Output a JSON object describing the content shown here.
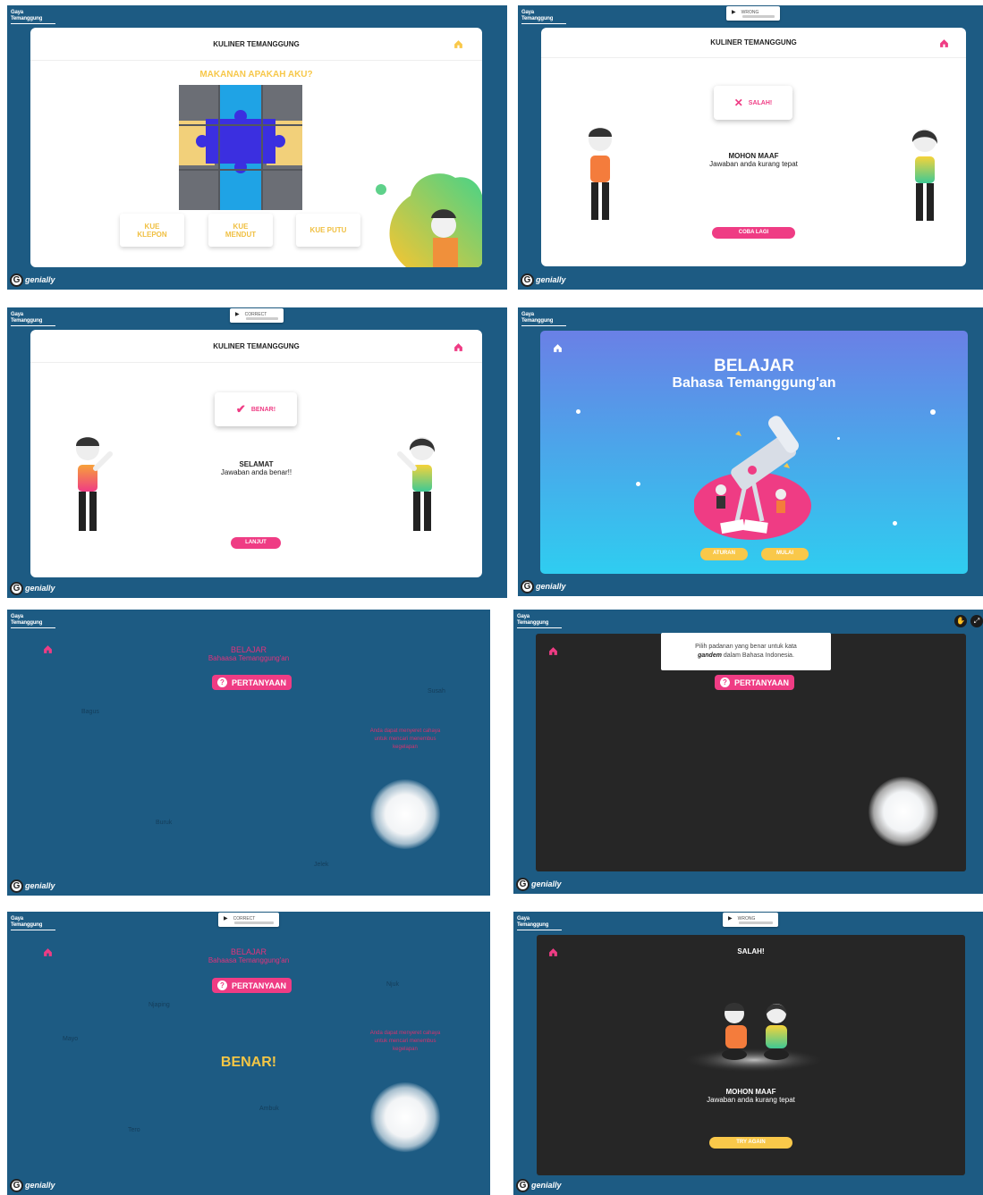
{
  "branding": {
    "logo_line1": "Gaya",
    "logo_line2": "Temanggung",
    "genially_label": "genially"
  },
  "player": {
    "labels": [
      "CORRECT",
      "WRONG"
    ]
  },
  "panel1": {
    "title": "KULINER TEMANGGUNG",
    "question": "MAKANAN APAKAH AKU?",
    "answers": [
      "KUE KLEPON",
      "KUE MENDUT",
      "KUE PUTU"
    ]
  },
  "panel2": {
    "title": "KULINER TEMANGGUNG",
    "feedback": "SALAH!",
    "heading": "MOHON MAAF",
    "message": "Jawaban anda kurang tepat",
    "button": "COBA LAGI"
  },
  "panel3": {
    "title": "KULINER TEMANGGUNG",
    "feedback": "BENAR!",
    "heading": "SELAMAT",
    "message": "Jawaban anda benar!!",
    "button": "LANJUT"
  },
  "panel4": {
    "title": "BELAJAR",
    "subtitle": "Bahasa Temanggung'an",
    "buttons": [
      "ATURAN",
      "MULAI"
    ]
  },
  "panel5": {
    "title": "BELAJAR",
    "subtitle": "Bahaasa Temanggung'an",
    "question_button": "PERTANYAAN",
    "words": [
      "Susah",
      "Bagus",
      "Buruk",
      "Jelek"
    ],
    "hint": "Anda dapat menyeret cahaya untuk mencari menembus kegelapan"
  },
  "panel6": {
    "question_button": "PERTANYAAN",
    "tooltip_line1": "Pilih padanan yang benar untuk kata",
    "tooltip_word": "gandem",
    "tooltip_line2_after": "dalam Bahasa Indonesia."
  },
  "panel7": {
    "title": "BELAJAR",
    "subtitle": "Bahaasa Temanggung'an",
    "question_button": "PERTANYAAN",
    "result": "BENAR!",
    "words": [
      "Njuk",
      "Njaping",
      "Mayo",
      "Ambuk",
      "Tero"
    ],
    "hint": "Anda dapat menyeret cahaya untuk mencari menembus kegelapan"
  },
  "panel8": {
    "title": "SALAH!",
    "heading": "MOHON MAAF",
    "message": "Jawaban anda kurang tepat",
    "button": "TRY AGAIN"
  },
  "colors": {
    "bg_blue": "#1d5b83",
    "pink": "#ef3c84",
    "yellow": "#f9c84a",
    "dark": "#222222"
  }
}
